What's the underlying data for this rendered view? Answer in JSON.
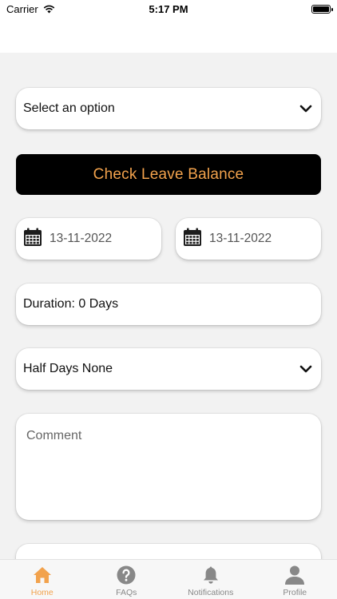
{
  "status_bar": {
    "carrier": "Carrier",
    "time": "5:17 PM"
  },
  "form": {
    "type_select": {
      "value": "Select an option"
    },
    "check_button": {
      "label": "Check Leave Balance"
    },
    "from_date": {
      "value": "13-11-2022"
    },
    "to_date": {
      "value": "13-11-2022"
    },
    "duration": {
      "text": "Duration: 0 Days"
    },
    "half_days": {
      "value": "Half Days None"
    },
    "comment": {
      "placeholder": "Comment",
      "value": ""
    }
  },
  "tabbar": {
    "tabs": [
      {
        "label": "Home",
        "icon": "home-icon",
        "active": true
      },
      {
        "label": "FAQs",
        "icon": "question-icon",
        "active": false
      },
      {
        "label": "Notifications",
        "icon": "bell-icon",
        "active": false
      },
      {
        "label": "Profile",
        "icon": "person-icon",
        "active": false
      }
    ]
  },
  "colors": {
    "accent": "#f2a24c",
    "button_bg": "#000000",
    "page_bg": "#f2f2f2",
    "inactive_tab": "#888888"
  }
}
